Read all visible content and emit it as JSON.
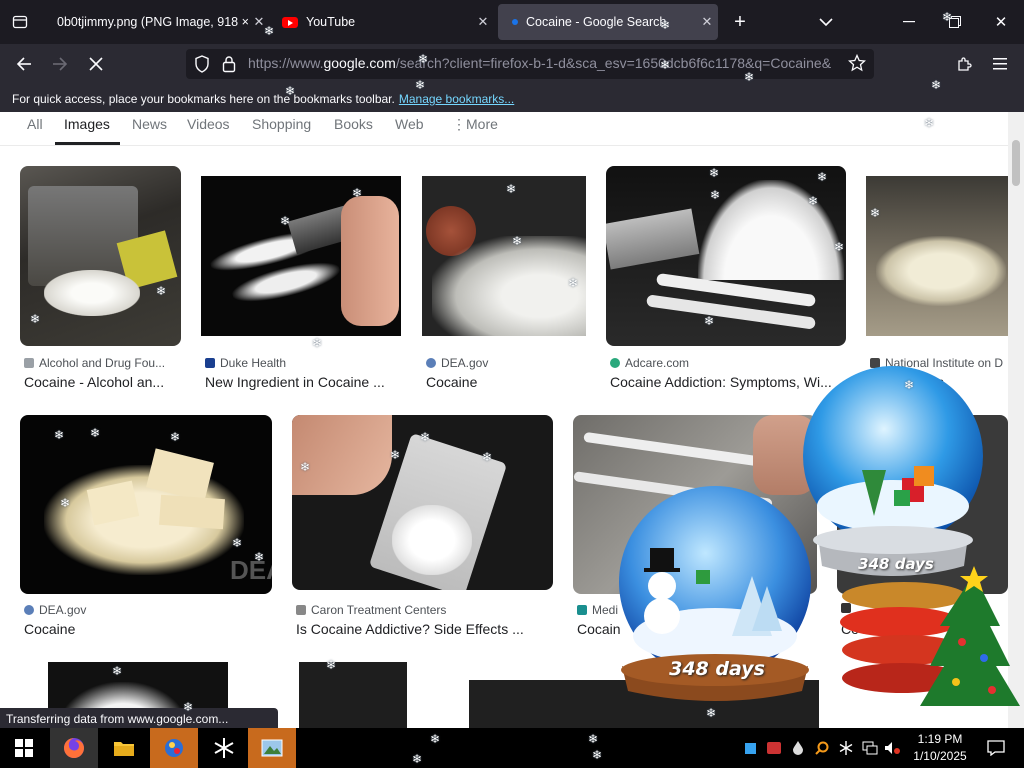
{
  "tabs": [
    {
      "title": "0b0tjimmy.png (PNG Image, 918 ×",
      "active": false
    },
    {
      "title": "YouTube",
      "active": false
    },
    {
      "title": "Cocaine - Google Search",
      "active": true
    }
  ],
  "nav": {
    "url_prefix": "https://www.",
    "url_domain": "google.com",
    "url_rest": "/search?client=firefox-b-1-d&sca_esv=1650dcb6f6c1178&q=Cocaine&"
  },
  "bookmarks_bar": {
    "text": "For quick access, place your bookmarks here on the bookmarks toolbar.",
    "link": "Manage bookmarks..."
  },
  "google_tabs": [
    "All",
    "Images",
    "News",
    "Videos",
    "Shopping",
    "Books",
    "Web",
    "More"
  ],
  "results_row1": [
    {
      "source": "Alcohol and Drug Fou...",
      "title": "Cocaine - Alcohol an...",
      "fav": "#9aa0a6"
    },
    {
      "source": "Duke Health",
      "title": "New Ingredient in Cocaine ...",
      "fav": "#1a3f8f"
    },
    {
      "source": "DEA.gov",
      "title": "Cocaine",
      "fav": "#5b7fb8"
    },
    {
      "source": "Adcare.com",
      "title": "Cocaine Addiction: Symptoms, Wi...",
      "fav": "#2aa87c"
    },
    {
      "source": "National Institute on D",
      "title": "National Ins",
      "fav": "#444"
    }
  ],
  "results_row2": [
    {
      "source": "DEA.gov",
      "title": "Cocaine",
      "fav": "#5b7fb8"
    },
    {
      "source": "Caron Treatment Centers",
      "title": "Is Cocaine Addictive? Side Effects ...",
      "fav": "#888"
    },
    {
      "source": "Medi",
      "title": "Cocain",
      "fav": "#1a8f8f"
    },
    {
      "source": "",
      "title": "Co",
      "fav": "#333"
    }
  ],
  "status_text": "Transferring data from www.google.com...",
  "widgets": {
    "globe_small_days": "348 days",
    "globe_big_days": "348 days"
  },
  "clock": {
    "time": "1:19 PM",
    "date": "1/10/2025"
  },
  "image_watermark": "DEA"
}
